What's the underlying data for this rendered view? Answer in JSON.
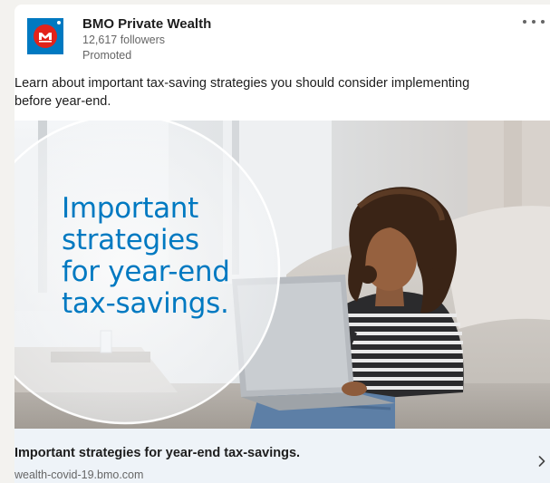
{
  "post": {
    "company_name": "BMO Private Wealth",
    "followers": "12,617 followers",
    "promoted": "Promoted",
    "more_icon": "more-horizontal-icon",
    "text_line1": "Learn about important tax-saving strategies you should consider implementing",
    "text_line2": "before year-end."
  },
  "ad_image": {
    "headline_line1": "Important",
    "headline_line2": "strategies",
    "headline_line3": "for year-end",
    "headline_line4": "tax-savings.",
    "description": "Woman with curly hair in a striped sweater working on a laptop in a bright living room"
  },
  "footer": {
    "title": "Important strategies for year-end tax-savings.",
    "url": "wealth-covid-19.bmo.com",
    "chevron_icon": "chevron-right-icon"
  },
  "colors": {
    "brand_blue": "#0079c1",
    "brand_red": "#e2231a",
    "footer_bg": "#eef3f8"
  }
}
